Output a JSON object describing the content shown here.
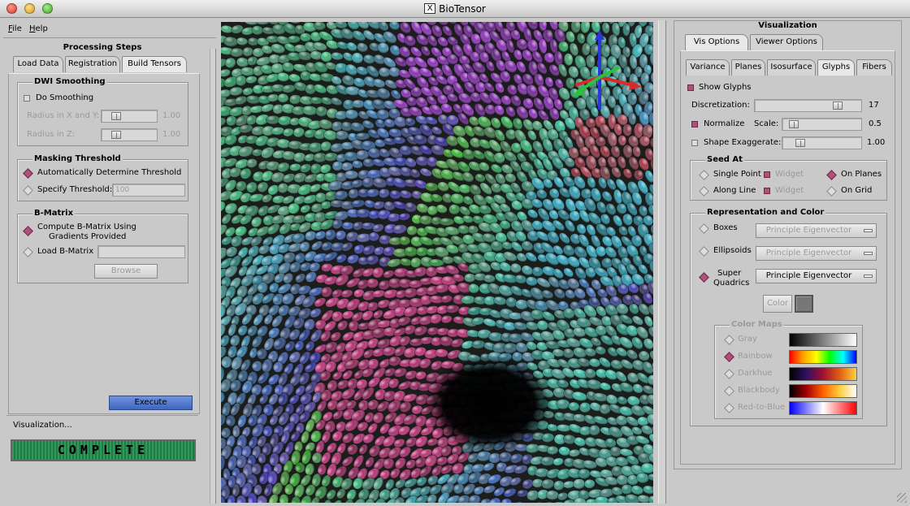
{
  "window": {
    "title": "BioTensor",
    "x_logo": "X"
  },
  "menu": {
    "file": "File",
    "help": "Help"
  },
  "left": {
    "header": "Processing Steps",
    "tabs": [
      "Load Data",
      "Registration",
      "Build Tensors"
    ],
    "dwi": {
      "title": "DWI Smoothing",
      "do_smoothing": "Do Smoothing",
      "radius_xy_label": "Radius in X and Y:",
      "radius_xy_value": "1.00",
      "radius_z_label": "Radius in Z:",
      "radius_z_value": "1.00"
    },
    "masking": {
      "title": "Masking Threshold",
      "auto": "Automatically Determine Threshold",
      "specify": "Specify Threshold:",
      "threshold_value": "100"
    },
    "bmatrix": {
      "title": "B-Matrix",
      "compute_line1": "Compute B-Matrix Using",
      "compute_line2": "Gradients Provided",
      "load": "Load B-Matrix",
      "browse": "Browse"
    },
    "execute": "Execute",
    "status": "Visualization...",
    "progress_text": "COMPLETE",
    "progress_fraction": 1.0
  },
  "right": {
    "header": "Visualization",
    "tabs": [
      "Vis Options",
      "Viewer Options"
    ],
    "subtabs": [
      "Variance",
      "Planes",
      "Isosurface",
      "Glyphs",
      "Fibers"
    ],
    "show_glyphs": "Show Glyphs",
    "discretization_label": "Discretization:",
    "discretization_value": "17",
    "normalize": "Normalize",
    "scale_label": "Scale:",
    "scale_value": "0.5",
    "shape_exag": "Shape Exaggerate:",
    "shape_exag_value": "1.00",
    "seed": {
      "title": "Seed At",
      "single_point": "Single Point",
      "along_line": "Along Line",
      "widget": "Widget",
      "on_planes": "On Planes",
      "on_grid": "On Grid"
    },
    "rep": {
      "title": "Representation and Color",
      "boxes": "Boxes",
      "ellipsoids": "Ellipsoids",
      "super1": "Super",
      "super2": "Quadrics",
      "principal": "Principle Eigenvector",
      "color": "Color"
    },
    "colormaps": {
      "title": "Color Maps",
      "items": [
        "Gray",
        "Rainbow",
        "Darkhue",
        "Blackbody",
        "Red-to-Blue"
      ]
    }
  },
  "colors": {
    "accent": "#b0507a",
    "execute": "#4a72c9",
    "progress": "#2f9a5b"
  }
}
